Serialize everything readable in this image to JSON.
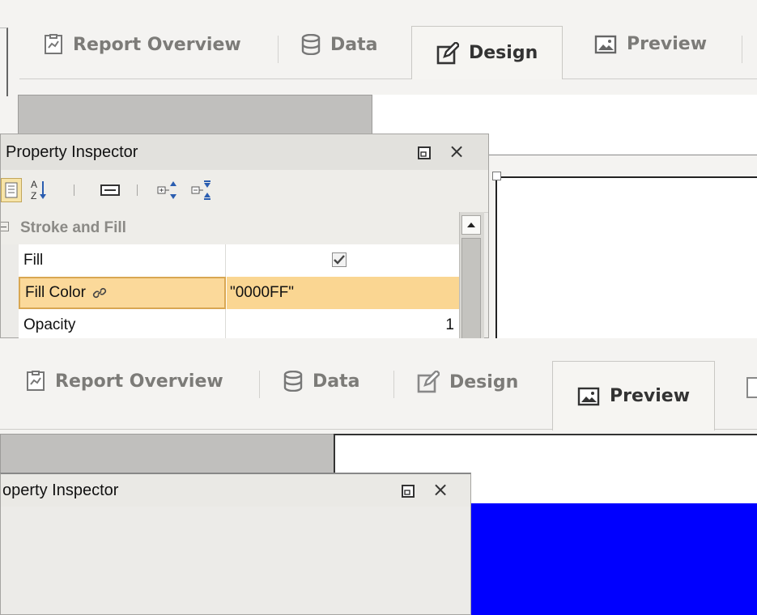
{
  "top": {
    "tabs": [
      {
        "label": "Report Overview",
        "icon": "report-overview-icon"
      },
      {
        "label": "Data",
        "icon": "database-icon"
      },
      {
        "label": "Design",
        "icon": "design-pencil-icon",
        "active": true
      },
      {
        "label": "Preview",
        "icon": "preview-image-icon"
      }
    ],
    "inspector": {
      "title": "Property Inspector",
      "restore_icon": "restore-window-icon",
      "close_glyph": "×",
      "toolbar_icons": [
        "categorized-icon",
        "sort-alpha-icon",
        "description-icon",
        "expand-all-icon",
        "collapse-all-icon"
      ],
      "category": {
        "label": "Stroke and Fill"
      },
      "rows": [
        {
          "name": "Fill",
          "value": "",
          "checkbox_checked": true
        },
        {
          "name": "Fill Color",
          "value": "\"0000FF\"",
          "selected": true,
          "icon": "link-icon"
        },
        {
          "name": "Opacity",
          "value": "1"
        }
      ]
    }
  },
  "bottom": {
    "tabs": [
      {
        "label": "Report Overview",
        "icon": "report-overview-icon"
      },
      {
        "label": "Data",
        "icon": "database-icon"
      },
      {
        "label": "Design",
        "icon": "design-pencil-icon"
      },
      {
        "label": "Preview",
        "icon": "preview-image-icon",
        "active": true
      }
    ],
    "inspector": {
      "title": "operty Inspector",
      "close_glyph": "×"
    }
  },
  "colors": {
    "accent_selected": "#fad692",
    "shape_fill": "#0000ff",
    "panel_bg": "#f4f3f1"
  }
}
